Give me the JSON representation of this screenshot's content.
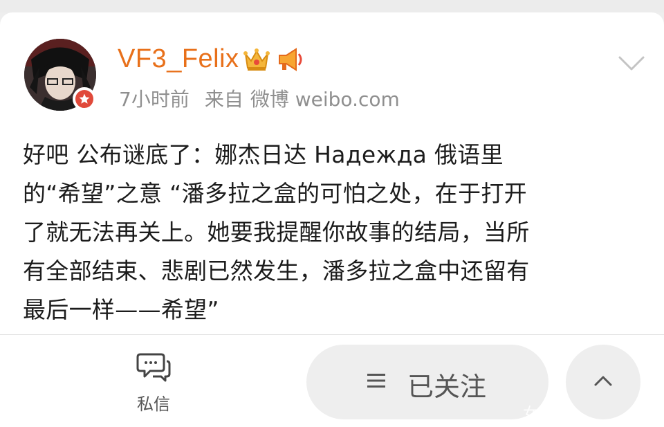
{
  "post": {
    "username": "VF3_Felix",
    "time": "7小时前",
    "source_prefix": "来自",
    "source_name": "微博 weibo.com",
    "lines": [
      "好吧 公布谜底了：娜杰日达 Надежда 俄语里",
      "的“希望”之意 “潘多拉之盒的可怕之处，在于打开",
      "了就无法再关上。她要我提醒你故事的结局，当所",
      "有全部结束、悲剧已然发生，潘多拉之盒中还留有",
      "最后一样——希望”"
    ]
  },
  "icons": {
    "crown": "crown-icon",
    "megaphone": "megaphone-icon",
    "chevron": "chevron-down-icon",
    "message": "message-icon",
    "menu": "menu-icon",
    "up": "chevron-up-icon",
    "badge": "verified-star-icon"
  },
  "bottom_bar": {
    "message_label": "私信",
    "follow_label": "已关注",
    "watermark": "女前诗"
  },
  "colors": {
    "username": "#e8701a",
    "meta": "#8f8f8f",
    "text": "#1c1c1c",
    "badge": "#e0493a",
    "button_bg": "#eeeeee"
  }
}
